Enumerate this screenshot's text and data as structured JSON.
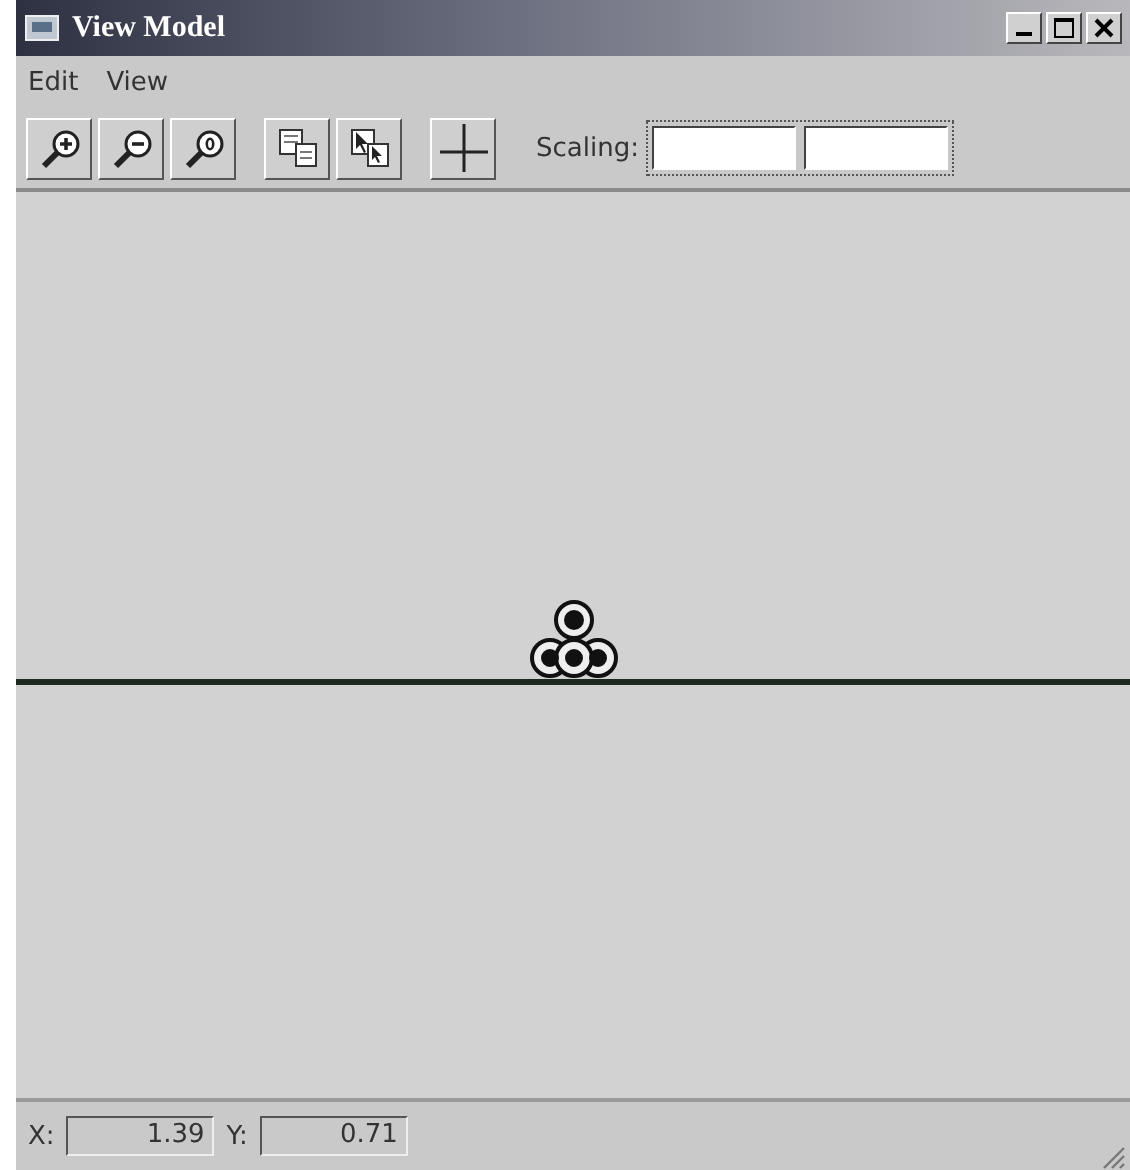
{
  "window": {
    "title": "View Model",
    "controls": [
      {
        "kind": "minimize"
      },
      {
        "kind": "maximize"
      },
      {
        "kind": "close"
      }
    ]
  },
  "menu": [
    {
      "label": "Edit"
    },
    {
      "label": "View"
    }
  ],
  "toolbar": {
    "groups": [
      [
        {
          "kind": "zoom-in"
        },
        {
          "kind": "zoom-out"
        },
        {
          "kind": "zoom-reset"
        }
      ],
      [
        {
          "kind": "copy"
        },
        {
          "kind": "copy-select"
        }
      ],
      [
        {
          "kind": "crosshair"
        }
      ]
    ],
    "scaling": {
      "label": "Scaling:",
      "fields": [
        {
          "kind": "text"
        },
        {
          "kind": "text"
        }
      ]
    }
  },
  "status_bar": {
    "x_label": "X:",
    "x_value": "1.39",
    "y_label": "Y:",
    "y_value": "0.71"
  }
}
